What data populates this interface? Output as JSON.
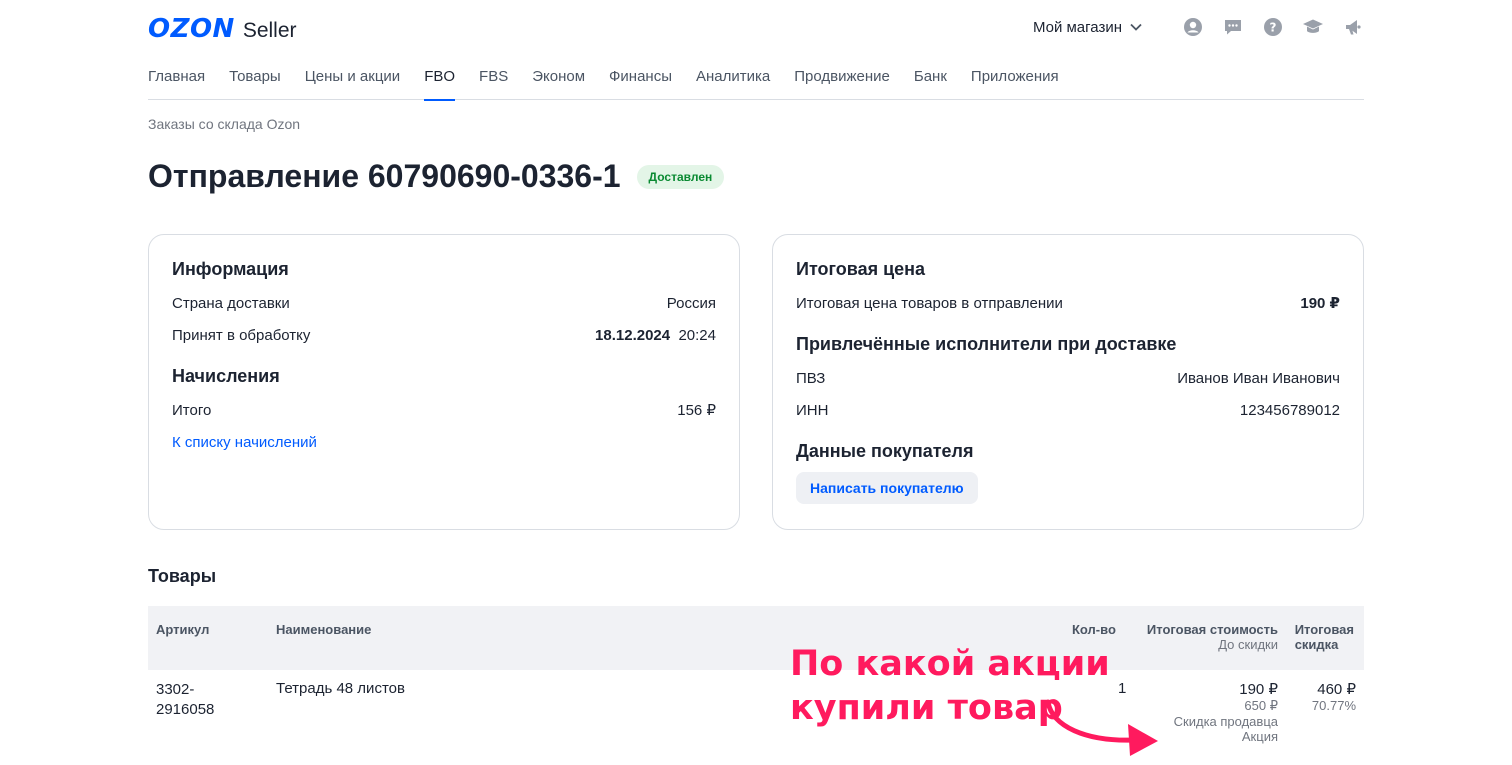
{
  "header": {
    "logo_brand": "OZON",
    "logo_product": "Seller",
    "store_label": "Мой магазин",
    "icons": [
      "user-icon",
      "chat-icon",
      "help-icon",
      "education-icon",
      "notifications-icon"
    ]
  },
  "nav": {
    "items": [
      {
        "label": "Главная",
        "active": false
      },
      {
        "label": "Товары",
        "active": false
      },
      {
        "label": "Цены и акции",
        "active": false
      },
      {
        "label": "FBO",
        "active": true
      },
      {
        "label": "FBS",
        "active": false
      },
      {
        "label": "Эконом",
        "active": false
      },
      {
        "label": "Финансы",
        "active": false
      },
      {
        "label": "Аналитика",
        "active": false
      },
      {
        "label": "Продвижение",
        "active": false
      },
      {
        "label": "Банк",
        "active": false
      },
      {
        "label": "Приложения",
        "active": false
      }
    ]
  },
  "breadcrumb": "Заказы со склада Ozon",
  "page": {
    "title": "Отправление 60790690-0336-1",
    "status": "Доставлен"
  },
  "info_card": {
    "title": "Информация",
    "country_label": "Страна доставки",
    "country_value": "Россия",
    "accepted_label": "Принят в обработку",
    "accepted_date": "18.12.2024",
    "accepted_time": "20:24",
    "accruals_title": "Начисления",
    "total_label": "Итого",
    "total_value": "156 ₽",
    "accruals_link": "К списку начислений"
  },
  "price_card": {
    "title": "Итоговая цена",
    "price_label": "Итоговая цена товаров в отправлении",
    "price_value": "190 ₽",
    "contractors_title": "Привлечённые исполнители при доставке",
    "pvz_label": "ПВЗ",
    "pvz_value": "Иванов Иван Иванович",
    "inn_label": "ИНН",
    "inn_value": "123456789012",
    "buyer_title": "Данные покупателя",
    "buyer_button": "Написать покупателю"
  },
  "goods": {
    "title": "Товары",
    "columns": {
      "article": "Артикул",
      "name": "Наименование",
      "qty": "Кол-во",
      "total_cost": "Итоговая стоимость",
      "total_cost_sub": "До скидки",
      "total_discount_1": "Итоговая",
      "total_discount_2": "скидка"
    },
    "rows": [
      {
        "article_1": "3302-",
        "article_2": "2916058",
        "name": "Тетрадь 48 листов",
        "qty": "1",
        "cost": "190 ₽",
        "cost_before": "650 ₽",
        "discount_type": "Скидка продавца",
        "promo": "Акция",
        "discount": "460 ₽",
        "discount_percent": "70.77%"
      }
    ]
  },
  "annotation": {
    "line1": "По какой акции",
    "line2": "купили товар",
    "color": "#ff1a5e"
  }
}
